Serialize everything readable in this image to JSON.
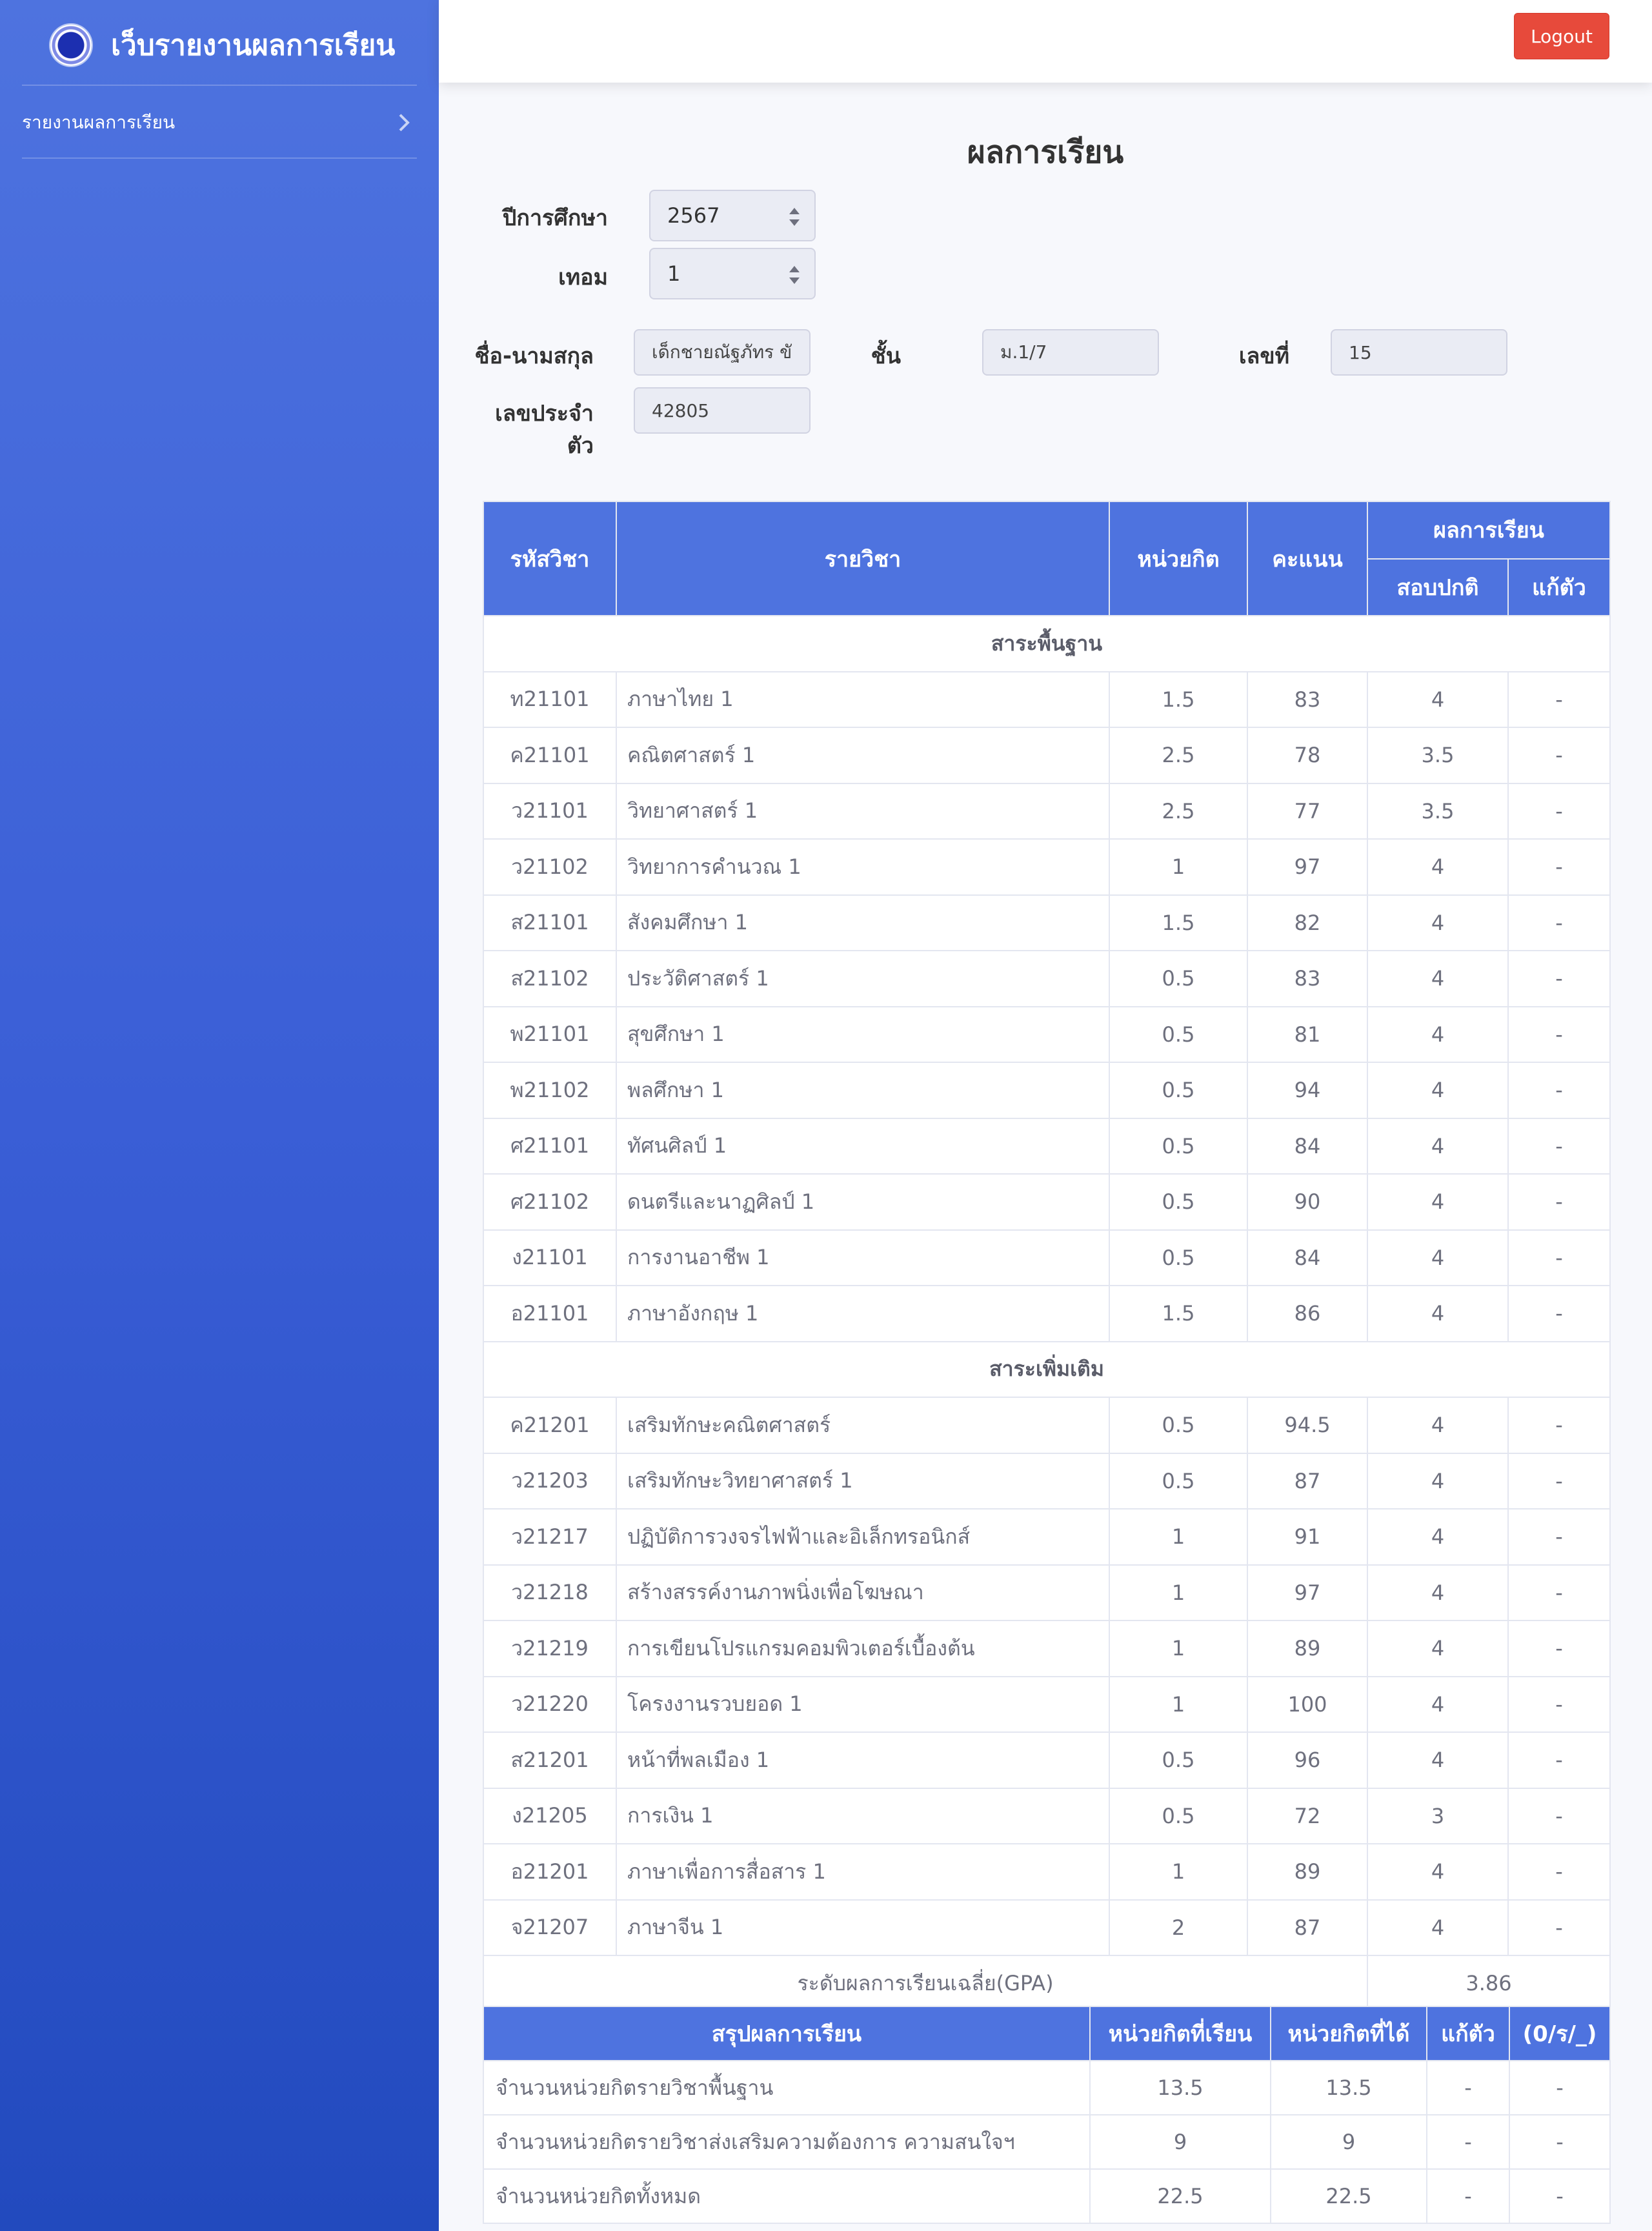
{
  "app": {
    "title": "เว็บรายงานผลการเรียน",
    "logout_label": "Logout"
  },
  "sidebar": {
    "items": [
      {
        "label": "รายงานผลการเรียน"
      }
    ]
  },
  "page": {
    "title": "ผลการเรียน"
  },
  "filters": {
    "year_label": "ปีการศึกษา",
    "year_value": "2567",
    "term_label": "เทอม",
    "term_value": "1"
  },
  "student": {
    "name_label": "ชื่อ-นามสกุล",
    "name_value": "เด็กชายณัฐภัทร ขั",
    "class_label": "ชั้น",
    "class_value": "ม.1/7",
    "number_label": "เลขที่",
    "number_value": "15",
    "id_label_line1": "เลขประจำ",
    "id_label_line2": "ตัว",
    "id_value": "42805"
  },
  "results": {
    "headers": {
      "code": "รหัสวิชา",
      "subject": "รายวิชา",
      "credit": "หน่วยกิต",
      "score": "คะแนน",
      "result": "ผลการเรียน",
      "normal": "สอบปกติ",
      "fix": "แก้ตัว"
    },
    "sections": [
      {
        "title": "สาระพื้นฐาน",
        "rows": [
          [
            "ท21101",
            "ภาษาไทย 1",
            "1.5",
            "83",
            "4",
            "-"
          ],
          [
            "ค21101",
            "คณิตศาสตร์ 1",
            "2.5",
            "78",
            "3.5",
            "-"
          ],
          [
            "ว21101",
            "วิทยาศาสตร์ 1",
            "2.5",
            "77",
            "3.5",
            "-"
          ],
          [
            "ว21102",
            "วิทยาการคำนวณ 1",
            "1",
            "97",
            "4",
            "-"
          ],
          [
            "ส21101",
            "สังคมศึกษา 1",
            "1.5",
            "82",
            "4",
            "-"
          ],
          [
            "ส21102",
            "ประวัติศาสตร์ 1",
            "0.5",
            "83",
            "4",
            "-"
          ],
          [
            "พ21101",
            "สุขศึกษา 1",
            "0.5",
            "81",
            "4",
            "-"
          ],
          [
            "พ21102",
            "พลศึกษา 1",
            "0.5",
            "94",
            "4",
            "-"
          ],
          [
            "ศ21101",
            "ทัศนศิลป์ 1",
            "0.5",
            "84",
            "4",
            "-"
          ],
          [
            "ศ21102",
            "ดนตรีและนาฏศิลป์ 1",
            "0.5",
            "90",
            "4",
            "-"
          ],
          [
            "ง21101",
            "การงานอาชีพ 1",
            "0.5",
            "84",
            "4",
            "-"
          ],
          [
            "อ21101",
            "ภาษาอังกฤษ 1",
            "1.5",
            "86",
            "4",
            "-"
          ]
        ]
      },
      {
        "title": "สาระเพิ่มเติม",
        "rows": [
          [
            "ค21201",
            "เสริมทักษะคณิตศาสตร์",
            "0.5",
            "94.5",
            "4",
            "-"
          ],
          [
            "ว21203",
            "เสริมทักษะวิทยาศาสตร์ 1",
            "0.5",
            "87",
            "4",
            "-"
          ],
          [
            "ว21217",
            "ปฏิบัติการวงจรไฟฟ้าและอิเล็กทรอนิกส์",
            "1",
            "91",
            "4",
            "-"
          ],
          [
            "ว21218",
            "สร้างสรรค์งานภาพนิ่งเพื่อโฆษณา",
            "1",
            "97",
            "4",
            "-"
          ],
          [
            "ว21219",
            "การเขียนโปรแกรมคอมพิวเตอร์เบื้องต้น",
            "1",
            "89",
            "4",
            "-"
          ],
          [
            "ว21220",
            "โครงงานรวบยอด 1",
            "1",
            "100",
            "4",
            "-"
          ],
          [
            "ส21201",
            "หน้าที่พลเมือง 1",
            "0.5",
            "96",
            "4",
            "-"
          ],
          [
            "ง21205",
            "การเงิน 1",
            "0.5",
            "72",
            "3",
            "-"
          ],
          [
            "อ21201",
            "ภาษาเพื่อการสื่อสาร 1",
            "1",
            "89",
            "4",
            "-"
          ],
          [
            "จ21207",
            "ภาษาจีน 1",
            "2",
            "87",
            "4",
            "-"
          ]
        ]
      }
    ],
    "gpa_label": "ระดับผลการเรียนเฉลี่ย(GPA)",
    "gpa_value": "3.86"
  },
  "summary": {
    "headers": [
      "สรุปผลการเรียน",
      "หน่วยกิตที่เรียน",
      "หน่วยกิตที่ได้",
      "แก้ตัว",
      "(0/ร/_)"
    ],
    "rows": [
      [
        "จำนวนหน่วยกิตรายวิชาพื้นฐาน",
        "13.5",
        "13.5",
        "-",
        "-"
      ],
      [
        "จำนวนหน่วยกิตรายวิชาส่งเสริมความต้องการ ความสนใจฯ",
        "9",
        "9",
        "-",
        "-"
      ],
      [
        "จำนวนหน่วยกิตทั้งหมด",
        "22.5",
        "22.5",
        "-",
        "-"
      ]
    ]
  }
}
